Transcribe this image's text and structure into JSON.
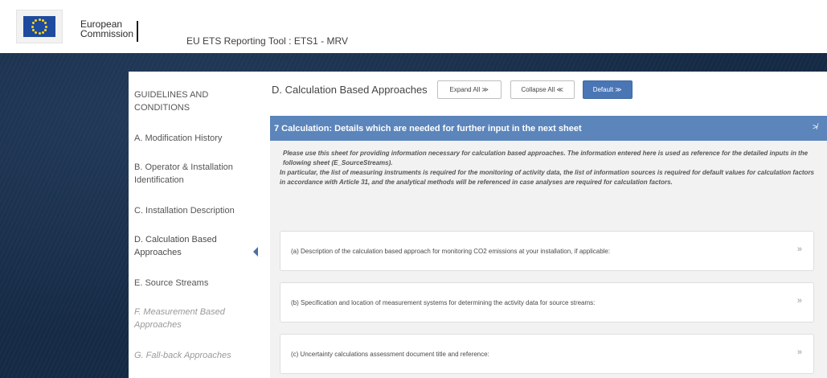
{
  "header": {
    "org_line1": "European",
    "org_line2": "Commission",
    "app_title": "EU ETS Reporting Tool : ETS1 - MRV"
  },
  "sidebar": {
    "items": [
      {
        "label": "GUIDELINES AND CONDITIONS",
        "state": "normal"
      },
      {
        "label": "A. Modification History",
        "state": "normal"
      },
      {
        "label": "B. Operator & Installation Identification",
        "state": "normal"
      },
      {
        "label": "C. Installation Description",
        "state": "normal"
      },
      {
        "label": "D. Calculation Based Approaches",
        "state": "active"
      },
      {
        "label": "E. Source Streams",
        "state": "normal"
      },
      {
        "label": "F. Measurement Based Approaches",
        "state": "disabled"
      },
      {
        "label": "G. Fall-back Approaches",
        "state": "disabled"
      }
    ]
  },
  "main": {
    "section_title": "D. Calculation Based Approaches",
    "expand_label": "Expand All ≫",
    "collapse_label": "Collapse All ≪",
    "default_label": "Default ≫",
    "accordion": {
      "title": "7 Calculation: Details which are needed for further input in the next sheet",
      "intro_p1": "Please use this sheet for providing information necessary for calculation based approaches. The information entered here is used as reference for the detailed inputs in the following sheet (E_SourceStreams).",
      "intro_p2": "In particular, the list of measuring instruments is required for the monitoring of activity data, the list of information sources is required for default values for calculation factors in accordance with Article 31, and the analytical methods will be referenced in case analyses are required for calculation factors."
    },
    "questions": [
      {
        "label": "(a) Description of the calculation based approach for monitoring CO2 emissions at your installation, if applicable:"
      },
      {
        "label": "(b) Specification and location of measurement systems for determining the activity data for source streams:"
      },
      {
        "label": "(c) Uncertainty calculations assessment document title and reference:"
      }
    ]
  },
  "colors": {
    "accent": "#4a76b5",
    "accordion_header": "#5b85bb",
    "background": "#152a45",
    "flag_blue": "#1f4b9e",
    "flag_star": "#ffd617"
  }
}
